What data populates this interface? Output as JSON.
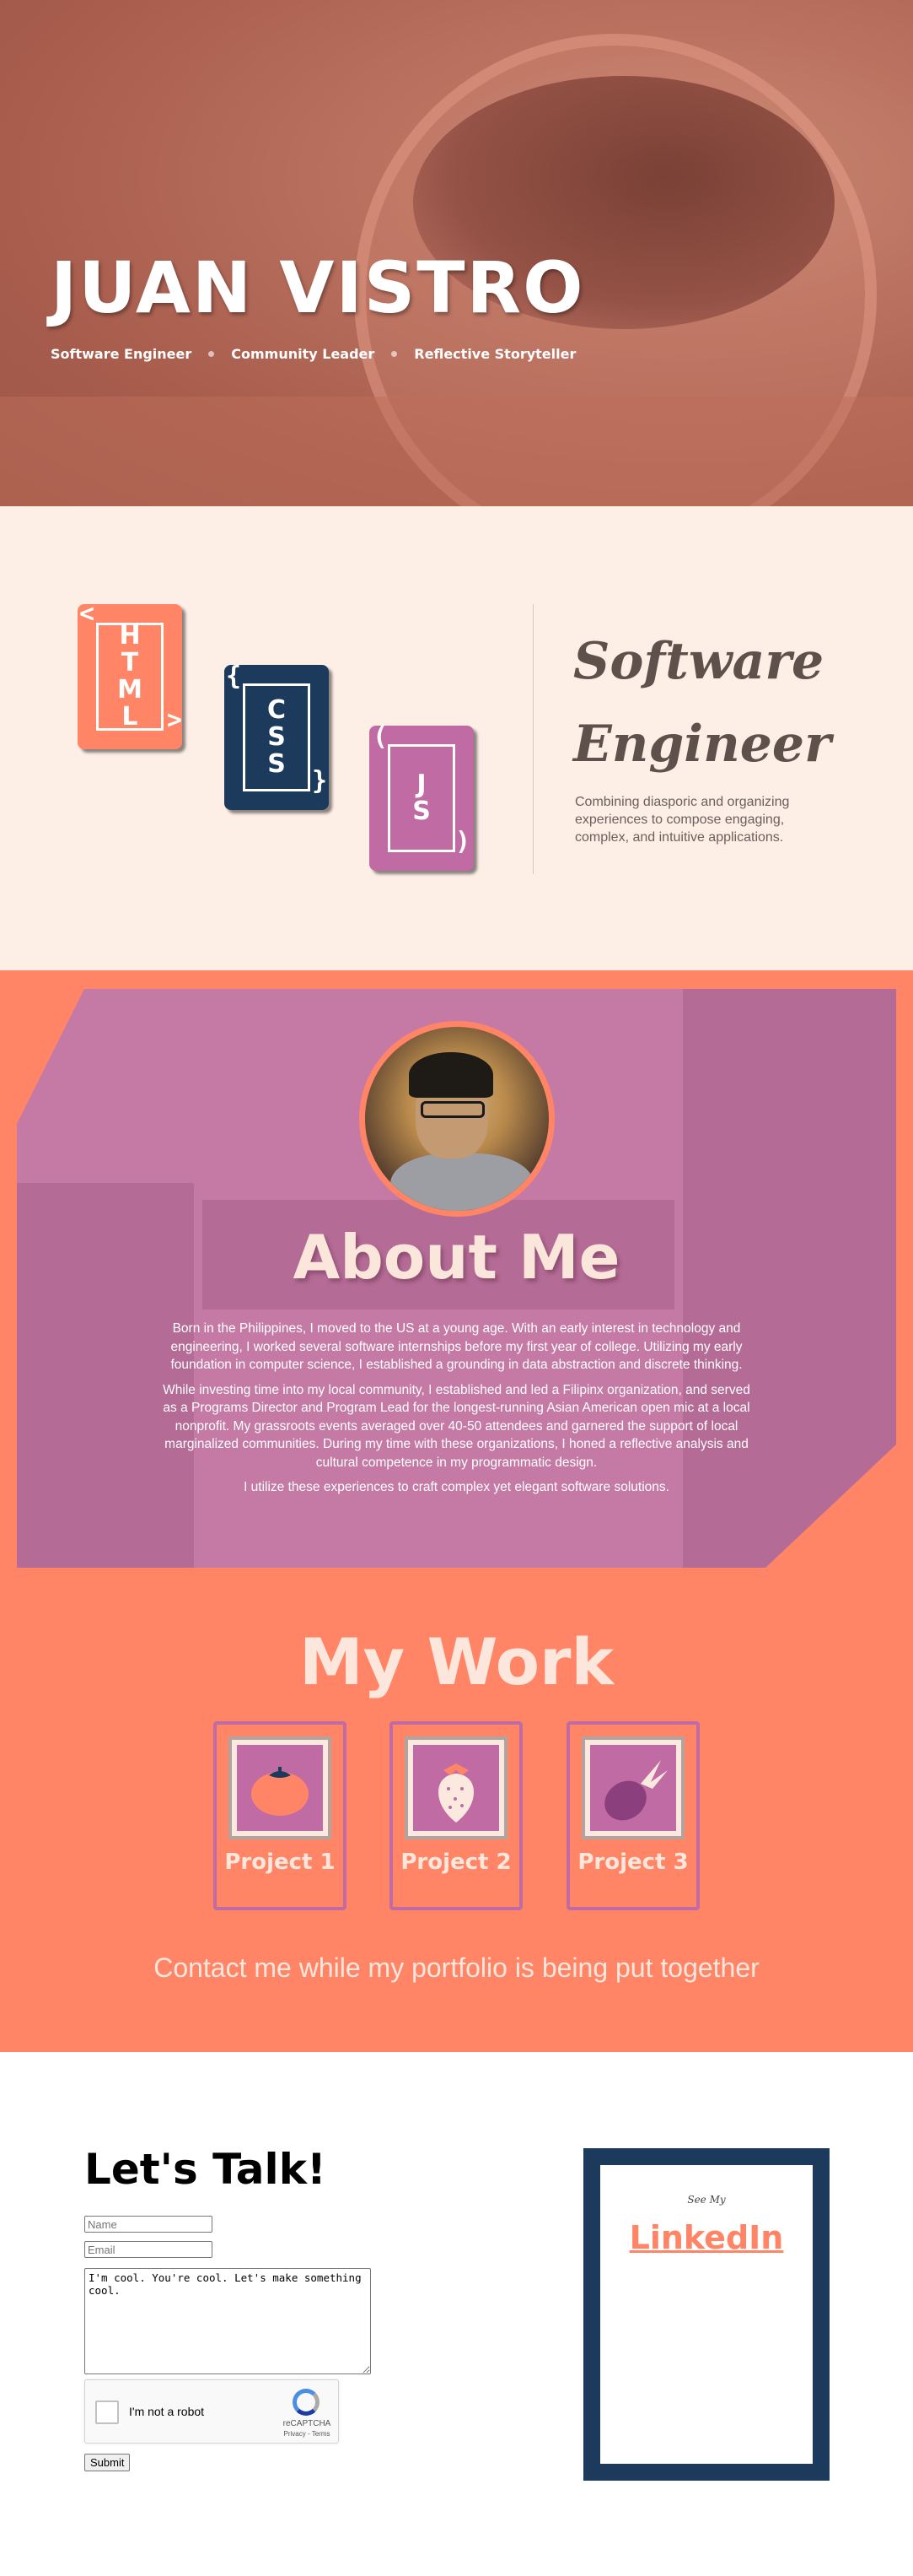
{
  "hero": {
    "name": "JUAN VISTRO",
    "roles": [
      "Software Engineer",
      "Community Leader",
      "Reflective Storyteller"
    ]
  },
  "skills": {
    "cards": [
      {
        "letters": "H\nT\nM\nL",
        "open": "<",
        "close": ">"
      },
      {
        "letters": "C\nS\nS",
        "open": "{",
        "close": "}"
      },
      {
        "letters": "J\nS",
        "open": "(",
        "close": ")"
      }
    ],
    "title": "Software Engineer",
    "description": "Combining diasporic and organizing experiences to compose engaging, complex, and intuitive applications."
  },
  "about": {
    "title": "About Me",
    "paragraphs": [
      "Born in the Philippines, I moved to the US at a young age. With an early interest in technology and engineering, I worked several software internships before my first year of college. Utilizing my early foundation in computer science, I established a grounding in data abstraction and discrete thinking.",
      "While investing time into my local community, I established and led a Filipinx organization, and served as a Programs Director and Program Lead for the longest-running Asian American open mic at a local nonprofit. My grassroots events averaged over 40-50 attendees and garnered the support of local marginalized communities. During my time with these organizations, I honed a reflective analysis and cultural competence in my programmatic design.",
      "I utilize these experiences to craft complex yet elegant software solutions."
    ]
  },
  "work": {
    "title": "My Work",
    "projects": [
      {
        "label": "Project 1",
        "icon": "tomato-icon"
      },
      {
        "label": "Project 2",
        "icon": "strawberry-icon"
      },
      {
        "label": "Project 3",
        "icon": "pineapple-icon"
      }
    ],
    "contact_message": "Contact me while my portfolio is being put together"
  },
  "talk": {
    "title": "Let's Talk!",
    "name_placeholder": "Name",
    "email_placeholder": "Email",
    "message_value": "I'm cool. You're cool. Let's make something cool.",
    "captcha_label": "I'm not a robot",
    "captcha_brand": "reCAPTCHA",
    "captcha_terms": "Privacy - Terms",
    "submit_label": "Submit",
    "see_my": "See My",
    "linkedin": "LinkedIn"
  },
  "colors": {
    "coral": "#ff8566",
    "navy": "#1c3a5c",
    "orchid": "#c16ba4",
    "cream": "#fdeee6"
  }
}
